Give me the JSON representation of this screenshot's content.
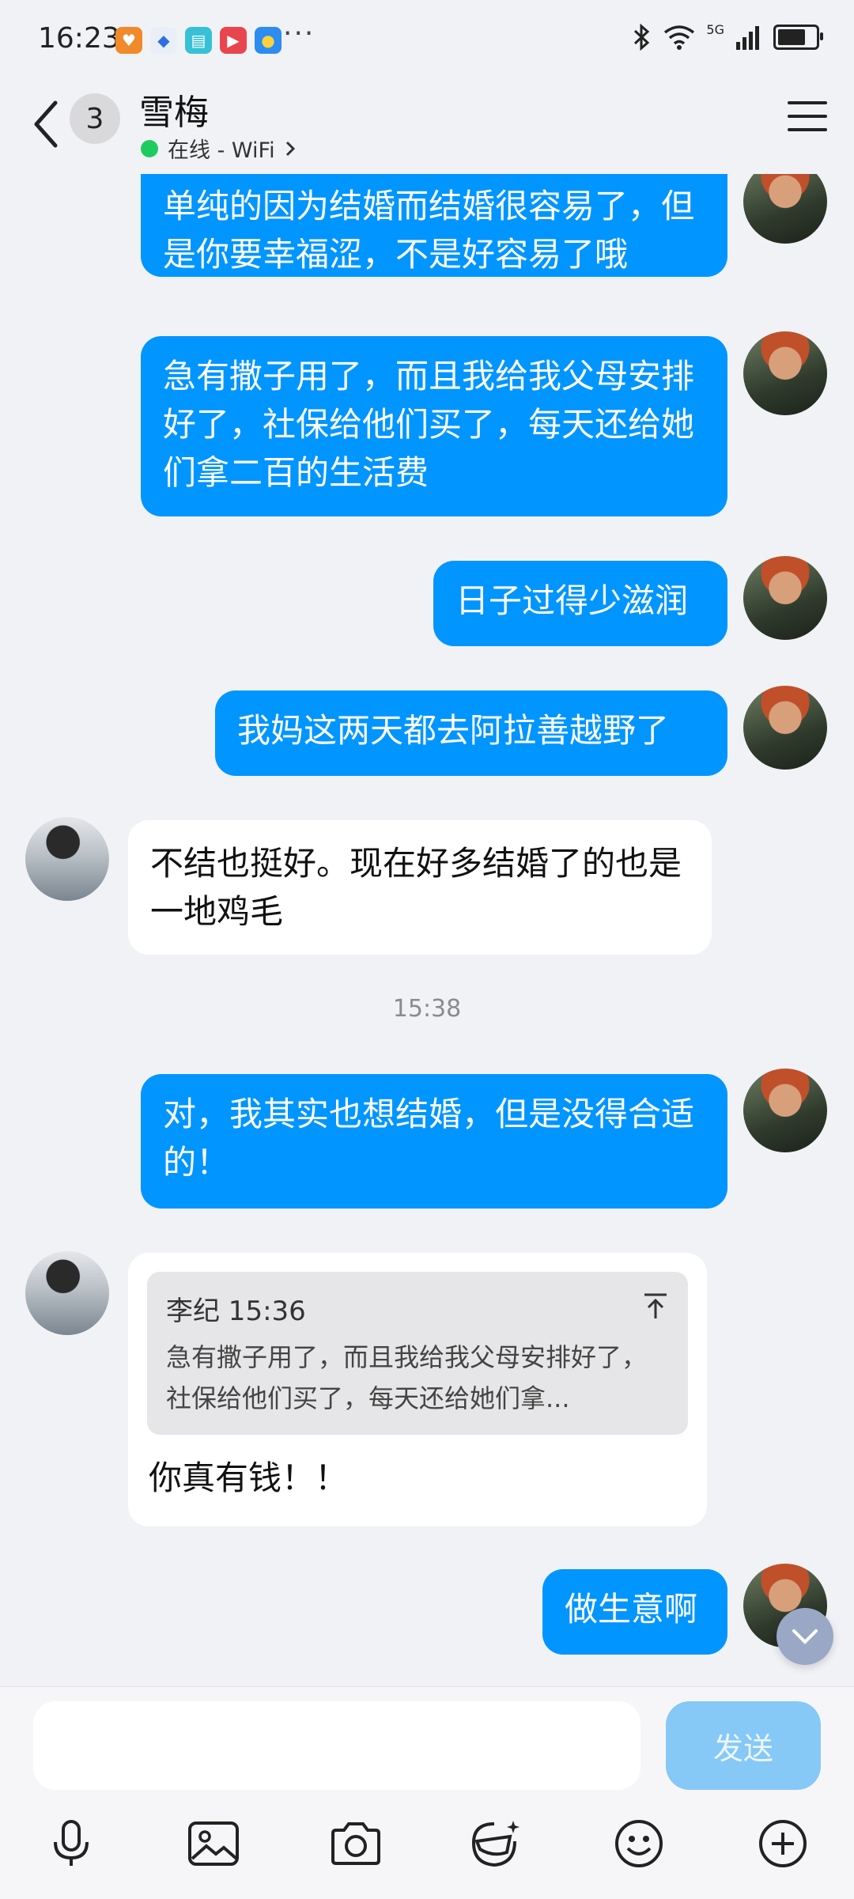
{
  "status_bar": {
    "time": "16:23",
    "more": "···",
    "network": "5G",
    "battery_level": 0.85,
    "app_icons": [
      "orange-heart-app-icon",
      "blue-app-icon",
      "teal-book-app-icon",
      "red-video-app-icon",
      "blue-yellow-app-icon"
    ],
    "status_icons": [
      "bluetooth-icon",
      "wifi-icon",
      "signal-icon",
      "battery-icon"
    ]
  },
  "header": {
    "unread_count": "3",
    "contact_name": "雪梅",
    "online_status": "在线 - WiFi",
    "online_dot_color": "#1ecb5f"
  },
  "messages": [
    {
      "direction": "out",
      "text": "单纯的因为结婚而结婚很容易了，但是你要幸福涩，不是好容易了哦"
    },
    {
      "direction": "out",
      "text": "急有撒子用了，而且我给我父母安排好了，社保给他们买了，每天还给她们拿二百的生活费"
    },
    {
      "direction": "out",
      "text": "日子过得少滋润"
    },
    {
      "direction": "out",
      "text": "我妈这两天都去阿拉善越野了"
    },
    {
      "direction": "in",
      "text": "不结也挺好。现在好多结婚了的也是一地鸡毛"
    },
    {
      "direction": "time",
      "text": "15:38"
    },
    {
      "direction": "out",
      "text": "对，我其实也想结婚，但是没得合适的！"
    },
    {
      "direction": "in",
      "quote_meta": "李纪 15:36",
      "quote_text": "急有撒子用了，而且我给我父母安排好了，社保给他们买了，每天还给她们拿...",
      "text": "你真有钱！！"
    },
    {
      "direction": "out",
      "text": "做生意啊"
    }
  ],
  "input": {
    "value": "",
    "send_label": "发送"
  },
  "toolbar_icons": [
    "microphone-icon",
    "image-icon",
    "camera-icon",
    "sticker-face-icon",
    "emoji-icon",
    "plus-icon"
  ],
  "colors": {
    "accent": "#0095ff",
    "send_disabled": "#86c8f6",
    "background": "#f1f2f6"
  }
}
